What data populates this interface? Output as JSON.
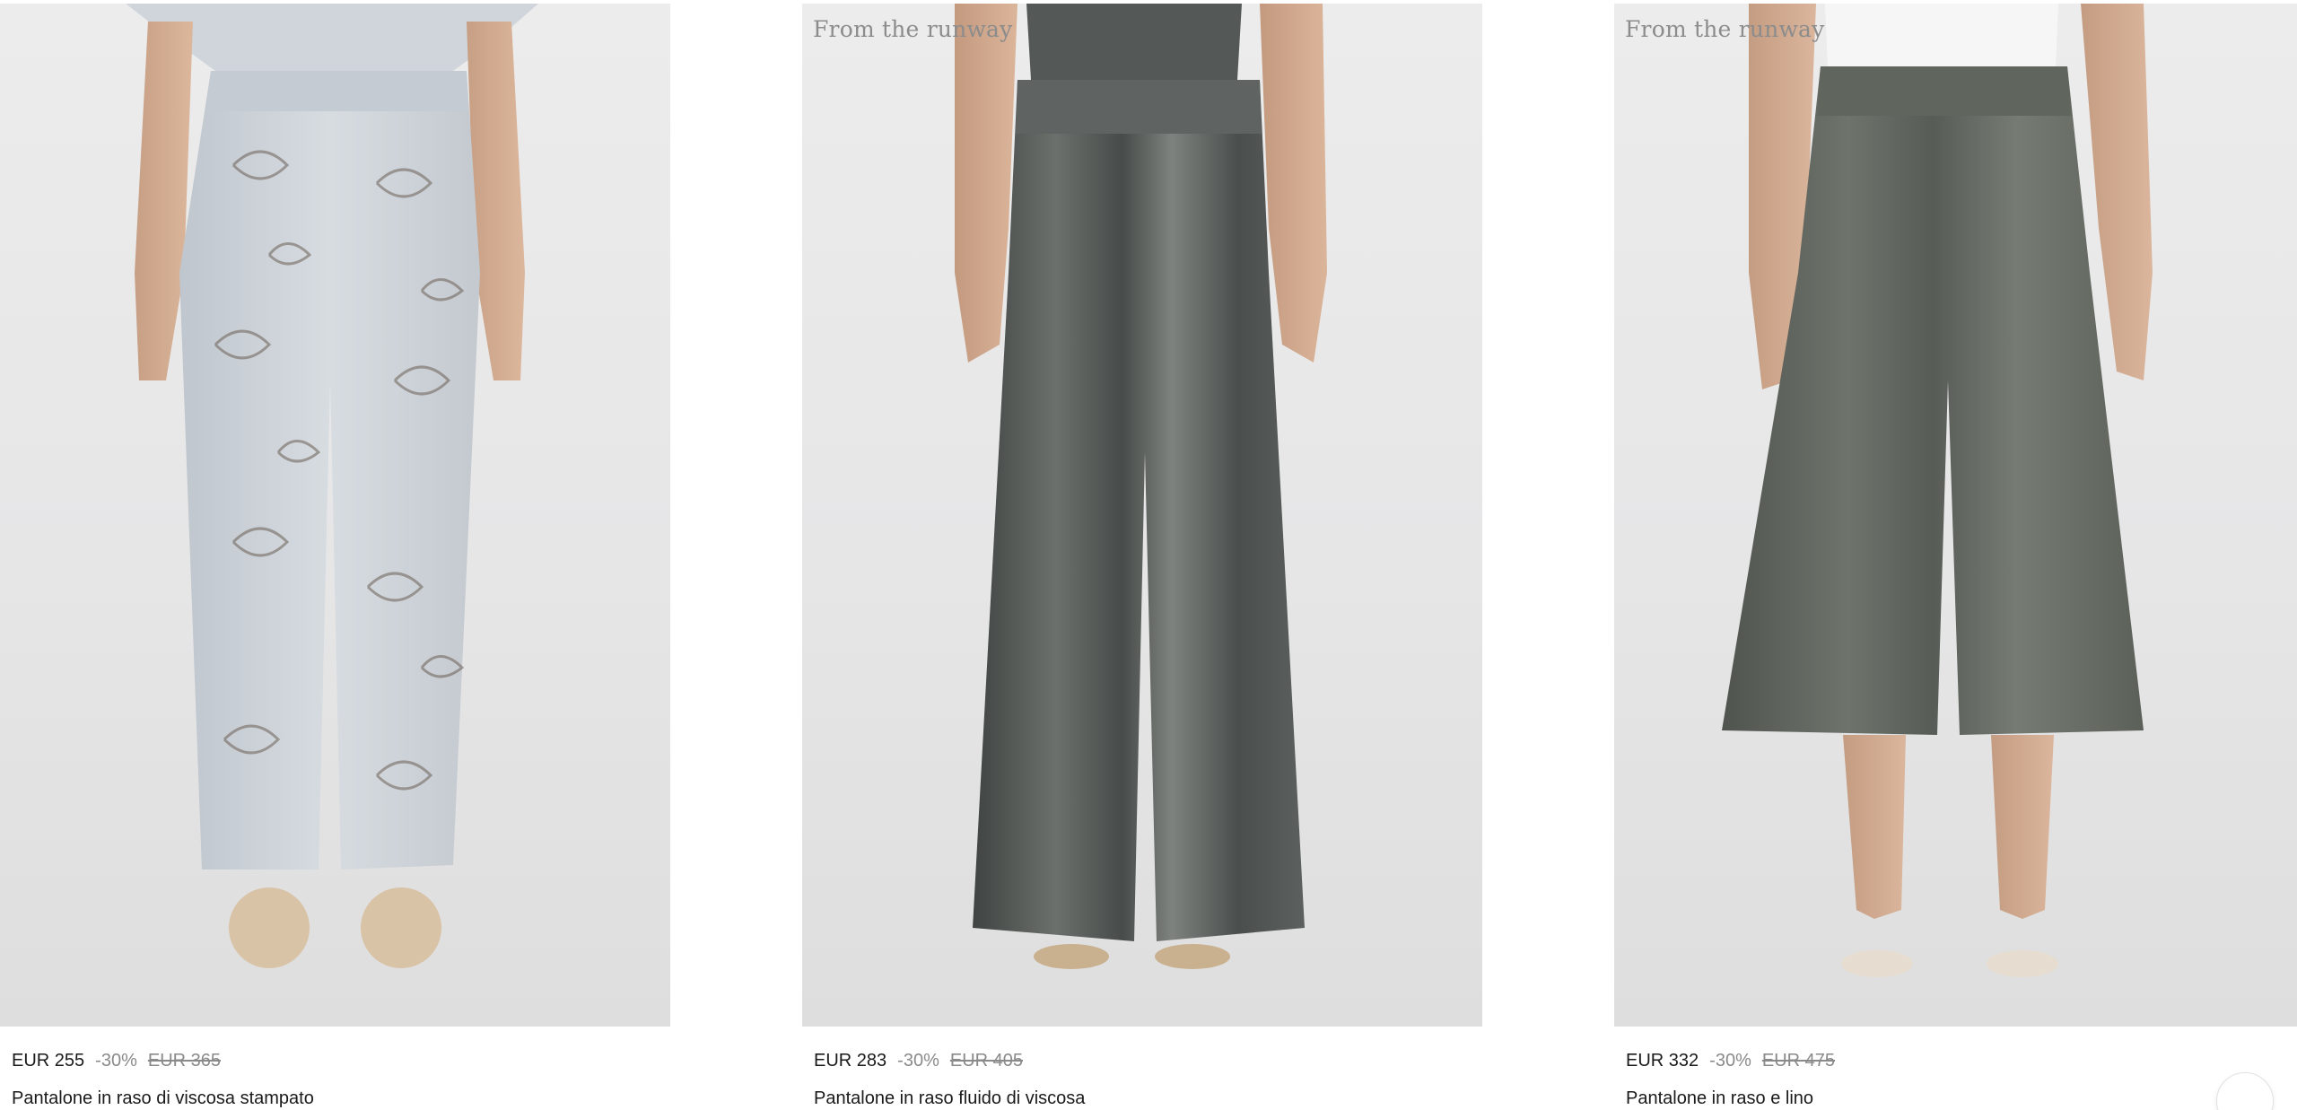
{
  "products": [
    {
      "badge": "",
      "price": "EUR 255",
      "discount": "-30%",
      "old_price": "EUR 365",
      "name": "Pantalone in raso di viscosa stampato",
      "colors": {
        "fabric": "#c9cfd6",
        "pattern": "#6b5f55"
      }
    },
    {
      "badge": "From the runway",
      "price": "EUR 283",
      "discount": "-30%",
      "old_price": "EUR 405",
      "name": "Pantalone in raso fluido di viscosa",
      "colors": {
        "fabric": "#4c504e",
        "highlight": "#8e928f"
      }
    },
    {
      "badge": "From the runway",
      "price": "EUR 332",
      "discount": "-30%",
      "old_price": "EUR 475",
      "name": "Pantalone in raso e lino",
      "colors": {
        "fabric": "#5a5f59",
        "highlight": "#7d827b"
      }
    }
  ],
  "icons": {
    "scroll_button": "circle-button-icon"
  }
}
